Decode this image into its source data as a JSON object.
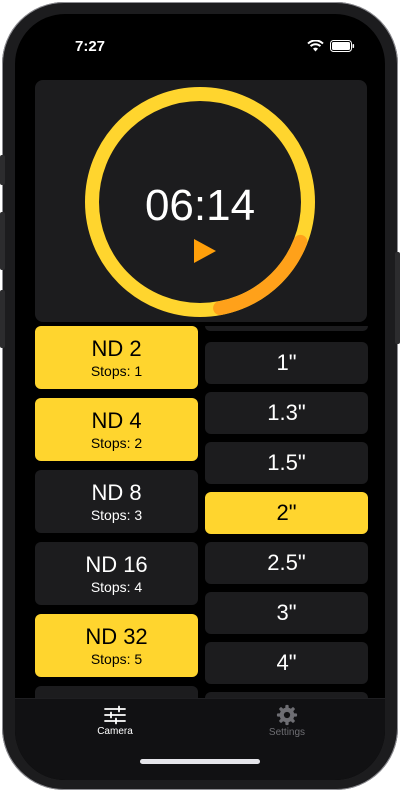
{
  "status_bar": {
    "time": "7:27"
  },
  "timer": {
    "display": "06:14",
    "progress": 0.84,
    "accent": "#ffd52e",
    "progress_color": "#ffa11a",
    "play_color": "#ff9f0a"
  },
  "filters": [
    {
      "name": "ND 2",
      "stops": "Stops: 1",
      "selected": true
    },
    {
      "name": "ND 4",
      "stops": "Stops: 2",
      "selected": true
    },
    {
      "name": "ND 8",
      "stops": "Stops: 3",
      "selected": false
    },
    {
      "name": "ND 16",
      "stops": "Stops: 4",
      "selected": false
    },
    {
      "name": "ND 32",
      "stops": "Stops: 5",
      "selected": true
    }
  ],
  "shutter_times": [
    {
      "label": "1\"",
      "selected": false
    },
    {
      "label": "1.3\"",
      "selected": false
    },
    {
      "label": "1.5\"",
      "selected": false
    },
    {
      "label": "2\"",
      "selected": true
    },
    {
      "label": "2.5\"",
      "selected": false
    },
    {
      "label": "3\"",
      "selected": false
    },
    {
      "label": "4\"",
      "selected": false
    }
  ],
  "tab_bar": {
    "camera_label": "Camera",
    "settings_label": "Settings",
    "active_color": "#ffffff",
    "inactive_color": "#6e6e73"
  }
}
